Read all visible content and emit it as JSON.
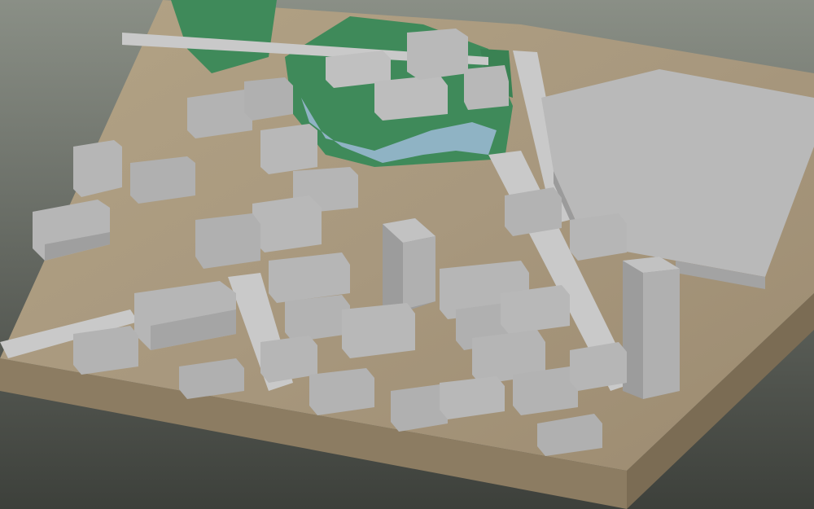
{
  "scene": {
    "kind": "3D city block model rendering",
    "colors": {
      "background_top": "#8a8f86",
      "background_bottom": "#3d403b",
      "ground": "#a8987e",
      "base_side": "#8c7c62",
      "park": "#3f8a5a",
      "water": "#8fb3c4",
      "building_roof": "#b9b9b9",
      "building_left": "#8f8f8f",
      "building_right": "#a3a3a3",
      "road": "#c9c9c9"
    }
  }
}
